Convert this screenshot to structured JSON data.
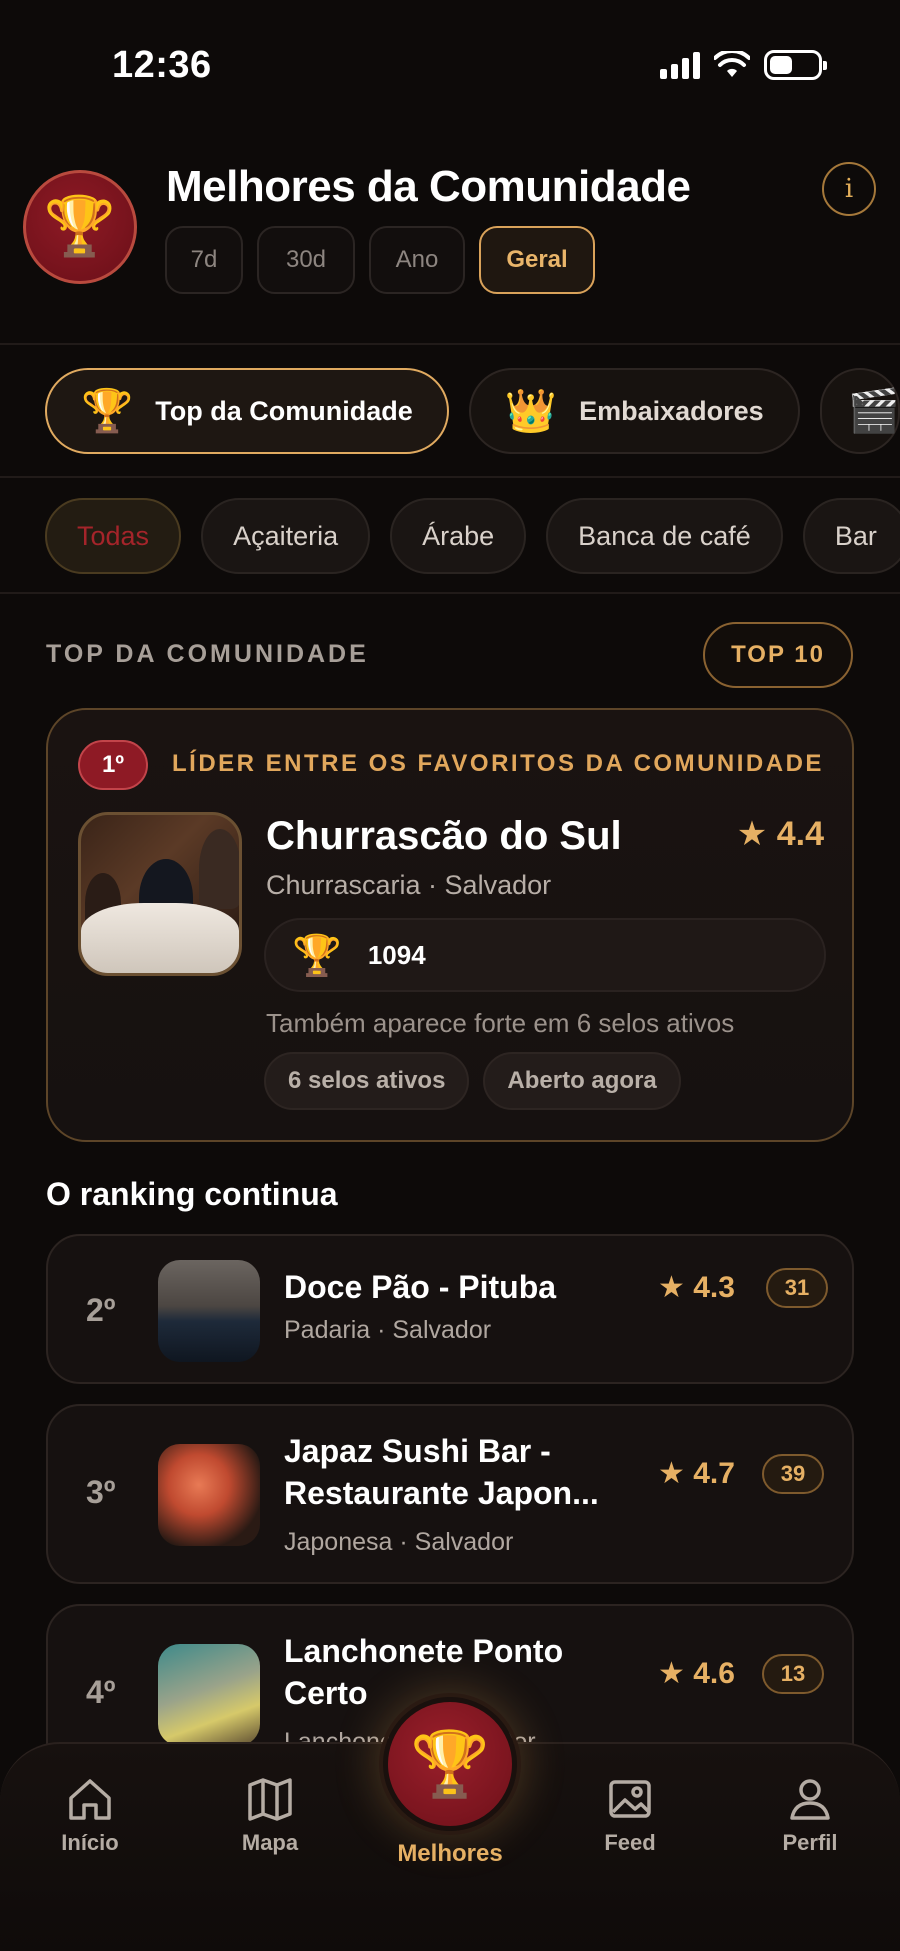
{
  "status": {
    "time": "12:36"
  },
  "header": {
    "title": "Melhores da Comunidade",
    "badge_icon": "trophy-icon",
    "periods": [
      "7d",
      "30d",
      "Ano",
      "Geral"
    ],
    "active_period": "Geral"
  },
  "tabs": [
    {
      "label": "Top da Comunidade",
      "icon": "🏆",
      "active": true
    },
    {
      "label": "Embaixadores",
      "icon": "👑",
      "active": false
    }
  ],
  "categories": [
    "Todas",
    "Açaiteria",
    "Árabe",
    "Banca de café",
    "Bar"
  ],
  "active_category": "Todas",
  "section": {
    "label": "TOP DA COMUNIDADE",
    "top_button": "TOP 10"
  },
  "leader": {
    "rank": "1º",
    "tag": "LÍDER ENTRE OS FAVORITOS DA COMUNIDADE",
    "name": "Churrascão do Sul",
    "rating": "★ 4.4",
    "subtitle": "Churrascaria · Salvador",
    "votes": "1094",
    "note": "Também aparece forte em 6 selos ativos",
    "pills": [
      "6 selos ativos",
      "Aberto agora"
    ]
  },
  "ranking": {
    "title": "O ranking continua",
    "items": [
      {
        "pos": "2º",
        "name": "Doce Pão - Pituba",
        "sub": "Padaria · Salvador",
        "rating": "★ 4.3",
        "count": "31"
      },
      {
        "pos": "3º",
        "name": "Japaz Sushi Bar - Restaurante Japon...",
        "sub": "Japonesa · Salvador",
        "rating": "★ 4.7",
        "count": "39"
      },
      {
        "pos": "4º",
        "name": "Lanchonete Ponto Certo",
        "sub": "Lanchonete · Salvador",
        "rating": "★ 4.6",
        "count": "13"
      }
    ]
  },
  "nav": {
    "home": "Início",
    "map": "Mapa",
    "best": "Melhores",
    "feed": "Feed",
    "profile": "Perfil"
  },
  "colors": {
    "accent": "#e6b064",
    "brand_red": "#8e1a25",
    "background": "#0d0a09"
  }
}
